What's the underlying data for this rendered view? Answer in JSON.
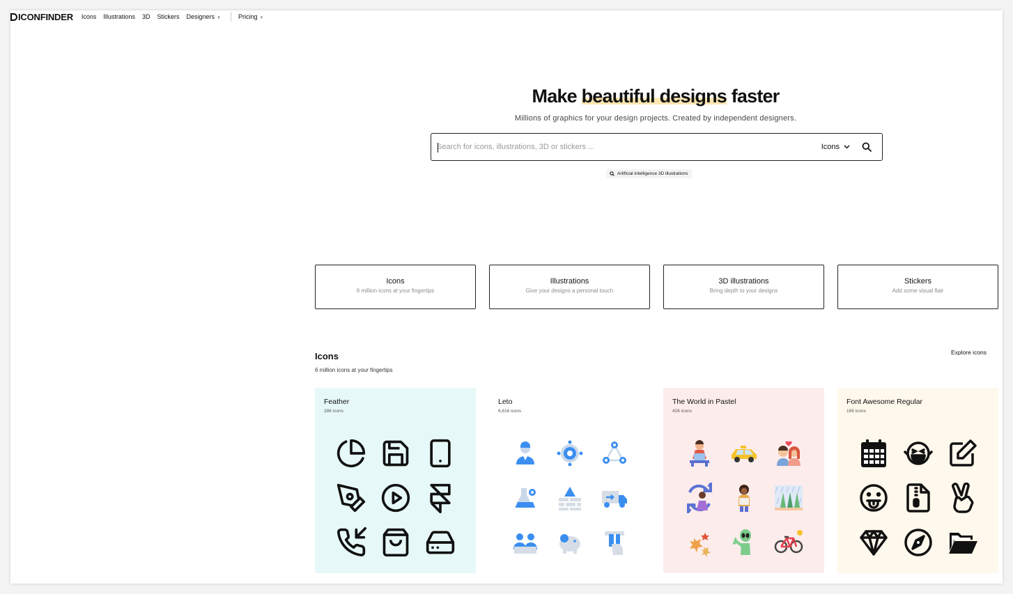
{
  "nav": {
    "logo": "ICONFINDER",
    "items": [
      "Icons",
      "Illustrations",
      "3D",
      "Stickers",
      "Designers"
    ],
    "pricing": "Pricing"
  },
  "hero": {
    "title_pre": "Make ",
    "title_hl": "beautiful designs",
    "title_post": " faster",
    "subtitle": "Millions of graphics for your design projects. Created by independent designers.",
    "search_placeholder": "Search for icons, illustrations, 3D or stickers ...",
    "search_type": "Icons",
    "suggestion": "Artificial intelligence 3D illustrations"
  },
  "categories": [
    {
      "title": "Icons",
      "subtitle": "6 million icons at your fingertips"
    },
    {
      "title": "Illustrations",
      "subtitle": "Give your designs a personal touch"
    },
    {
      "title": "3D illustrations",
      "subtitle": "Bring depth to your designs"
    },
    {
      "title": "Stickers",
      "subtitle": "Add some visual flair"
    }
  ],
  "section": {
    "title": "Icons",
    "subtitle": "6 million icons at your fingertips",
    "explore": "Explore icons"
  },
  "sets": [
    {
      "name": "Feather",
      "count": "286 icons",
      "bg": "#e6f9f8",
      "icons": [
        "pie-chart-icon",
        "save-icon",
        "tablet-icon",
        "pen-tool-icon",
        "play-circle-icon",
        "framer-icon",
        "phone-incoming-icon",
        "shopping-bag-icon",
        "hard-drive-icon"
      ]
    },
    {
      "name": "Leto",
      "count": "6,616 icons",
      "bg": "#ffffff",
      "icons": [
        "user-icon",
        "settings-gear-icon",
        "network-icon",
        "flask-icon",
        "brick-wall-icon",
        "delivery-truck-icon",
        "team-icon",
        "piggy-bank-icon",
        "atm-card-icon"
      ]
    },
    {
      "name": "The World in Pastel",
      "count": "426 icons",
      "bg": "#fdecec",
      "icons": [
        "reader-icon",
        "taxi-icon",
        "couple-icon",
        "recycle-icon",
        "woman-icon",
        "rain-trees-icon",
        "autumn-leaves-icon",
        "alien-icon",
        "bicycle-icon"
      ]
    },
    {
      "name": "Font Awesome Regular",
      "count": "169 icons",
      "bg": "#fff8ec",
      "icons": [
        "calendar-icon",
        "laughing-face-icon",
        "edit-icon",
        "tongue-face-icon",
        "zip-file-icon",
        "peace-hand-icon",
        "gem-icon",
        "compass-icon",
        "folder-open-icon"
      ]
    }
  ]
}
